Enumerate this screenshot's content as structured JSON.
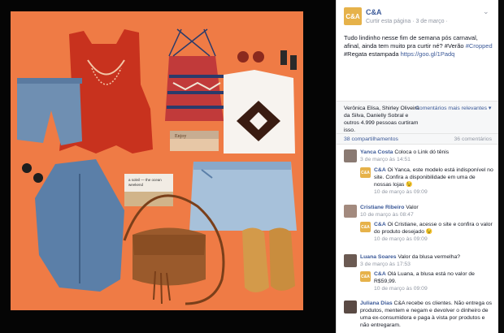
{
  "page": {
    "name": "C&A",
    "logo_text": "C&A",
    "meta_line": "Curtir esta página · 3 de março ·",
    "post_text_1": "Tudo lindinho nesse fim de semana pós carnaval, afinal, ainda tem muito pra curtir né? #Verão",
    "post_link_tag": "#Cropped",
    "post_text_2": " #Regata estampada ",
    "post_link": "https://goo.gl/1Padq"
  },
  "likes": {
    "text": "Verônica Elisa, Shirley Oliveira da Silva, Danielly Sobral e outros 4.999 pessoas curtiram isso.",
    "more_comments": "Comentários mais relevantes ▾"
  },
  "shares": {
    "left": "38 compartilhamentos",
    "right": "36 comentários"
  },
  "comments": [
    {
      "name": "Yanca Costa",
      "text": " Coloca o Link dó tênis",
      "date": "3 de março às 14:51"
    },
    {
      "name": "C&A",
      "text": " Oi Yanca, este modelo está indisponível no site. Confira a disponibilidade em uma de nossas lojas 😉",
      "date": "10 de março às 09:09"
    },
    {
      "name": "Cristiane Ribeiro",
      "text": " Valor",
      "date": "10 de março às 08:47"
    },
    {
      "name": "C&A",
      "text": " Oi Cristiane, acesse o site e confira o valor do produto desejado 😉",
      "date": "10 de março às 09:09"
    },
    {
      "name": "Luana Soares",
      "text": " Valor da blusa vermelha?",
      "date": "3 de março às 17:53"
    },
    {
      "name": "C&A",
      "text": " Olá Luana, a blusa está no valor de R$59,99.",
      "date": "10 de março às 09:09"
    },
    {
      "name": "Juliana Dias",
      "text": " C&A recebe os clientes. Não entrega os produtos, mentem e negam e devolver o dinheiro de uma ex-consumidora e paga à vista por produtos e não entregaram.",
      "date": ""
    }
  ],
  "photo": {
    "tag_text": "Enjoy",
    "clutch_text": "a soleil — the ocean weekend"
  },
  "colors": {
    "background": "#ef7b45",
    "link": "#3b5998",
    "brand": "#e6b24a"
  }
}
